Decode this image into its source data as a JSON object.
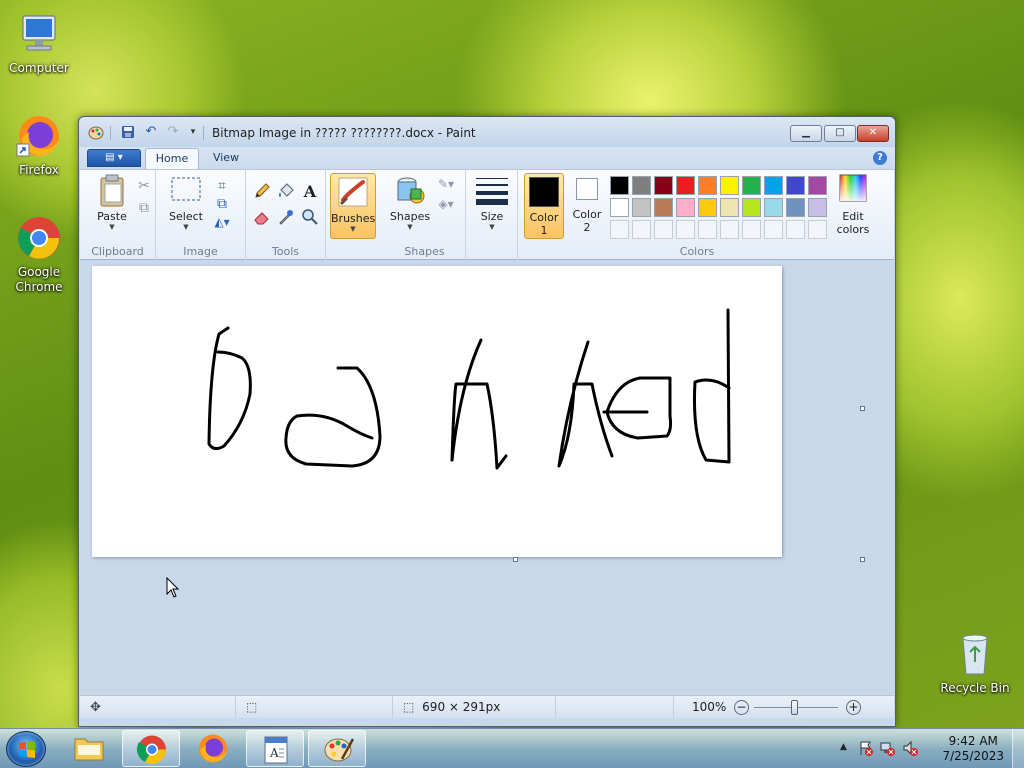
{
  "desktop": {
    "icons": [
      {
        "label": "Computer"
      },
      {
        "label": "Firefox"
      },
      {
        "label": "Google Chrome"
      },
      {
        "label": "Recycle Bin"
      }
    ]
  },
  "window": {
    "title": "Bitmap Image in ????? ????????.docx - Paint",
    "buttons": {
      "minimize": "▁",
      "maximize": "□",
      "close": "✕"
    }
  },
  "ribbon": {
    "tabs": [
      {
        "label": "Home",
        "active": true
      },
      {
        "label": "View",
        "active": false
      }
    ],
    "help": "?",
    "groups": {
      "clipboard": {
        "label": "Clipboard",
        "paste": "Paste"
      },
      "image": {
        "label": "Image",
        "select": "Select"
      },
      "tools": {
        "label": "Tools"
      },
      "brushes": {
        "label": "Brushes"
      },
      "shapes": {
        "label": "Shapes",
        "shapes_btn": "Shapes"
      },
      "size": {
        "label": "Size"
      },
      "colors": {
        "label": "Colors",
        "color1": "Color 1",
        "color2": "Color 2",
        "edit_colors": "Edit colors",
        "color1_value": "#000000",
        "color2_value": "#ffffff",
        "palette_row1": [
          "#000000",
          "#7f7f7f",
          "#880015",
          "#ed1c24",
          "#ff7f27",
          "#fff200",
          "#22b14c",
          "#00a2e8",
          "#3f48cc",
          "#a349a4"
        ],
        "palette_row2": [
          "#ffffff",
          "#c3c3c3",
          "#b97a57",
          "#ffaec9",
          "#ffc90e",
          "#efe4b0",
          "#b5e61d",
          "#99d9ea",
          "#7092be",
          "#c8bfe7"
        ]
      }
    }
  },
  "canvas": {
    "text_drawn": "banked",
    "stroke_color": "#000000"
  },
  "statusbar": {
    "dimensions": "690 × 291px",
    "zoom": "100%",
    "zoom_level": 1.0
  },
  "taskbar": {
    "items": [
      "Windows Explorer",
      "Google Chrome",
      "Firefox",
      "WordPad",
      "Paint"
    ],
    "clock_time": "9:42 AM",
    "clock_date": "7/25/2023"
  }
}
